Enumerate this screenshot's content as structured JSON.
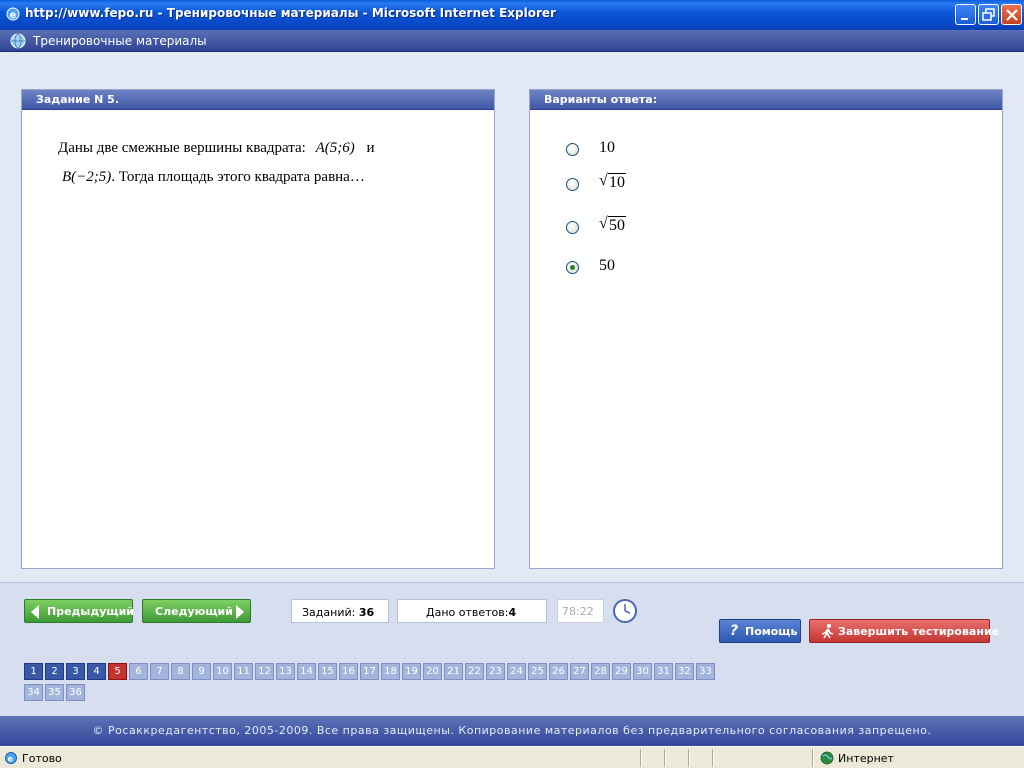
{
  "window": {
    "title": "http://www.fepo.ru - Тренировочные материалы - Microsoft Internet Explorer"
  },
  "app": {
    "title": "Тренировочные материалы"
  },
  "question": {
    "header": "Задание N 5.",
    "text_part1": "Даны две смежные вершины квадрата:",
    "point_a": "A(5;6)",
    "conj": "и",
    "point_b": "B(−2;5)",
    "text_part2": ". Тогда площадь этого квадрата равна…"
  },
  "answers": {
    "header": "Варианты ответа:",
    "options": [
      {
        "label": "10",
        "sqrt": false,
        "checked": false
      },
      {
        "label": "10",
        "sqrt": true,
        "checked": false
      },
      {
        "label": "50",
        "sqrt": true,
        "checked": false
      },
      {
        "label": "50",
        "sqrt": false,
        "checked": true
      }
    ]
  },
  "nav": {
    "prev_label": "Предыдущий",
    "next_label": "Следующий",
    "tasks_label": "Заданий:",
    "tasks_count": "36",
    "answered_label": "Дано ответов:",
    "answered_count": "4",
    "timer": "78:22",
    "help_label": "Помощь",
    "finish_label": "Завершить тестирование"
  },
  "questions_grid": {
    "numbers": [
      "1",
      "2",
      "3",
      "4",
      "5",
      "6",
      "7",
      "8",
      "9",
      "10",
      "11",
      "12",
      "13",
      "14",
      "15",
      "16",
      "17",
      "18",
      "19",
      "20",
      "21",
      "22",
      "23",
      "24",
      "25",
      "26",
      "27",
      "28",
      "29",
      "30",
      "31",
      "32",
      "33",
      "34",
      "35",
      "36"
    ],
    "answered": [
      "1",
      "2",
      "3",
      "4"
    ],
    "current": "5"
  },
  "footer": {
    "copyright": "© Росаккредагентство, 2005-2009. Все права защищены. Копирование материалов без предварительного согласования запрещено."
  },
  "statusbar": {
    "status": "Готово",
    "zone": "Интернет"
  },
  "colors": {
    "answered_cell": "#3a58a8",
    "current_cell": "#c7312e",
    "unanswered_cell": "#a3b4dd"
  }
}
